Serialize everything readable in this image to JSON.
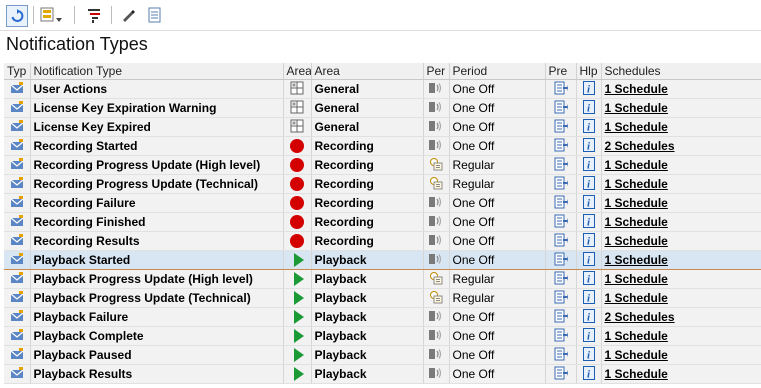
{
  "title": "Notification Types",
  "columns": {
    "typ": "Typ",
    "notification_type": "Notification Type",
    "area_icon": "Area",
    "area": "Area",
    "per": "Per",
    "period": "Period",
    "pre": "Pre",
    "hlp": "Hlp",
    "schedules": "Schedules"
  },
  "rows": [
    {
      "name": "User Actions",
      "area_icon": "table-icon",
      "area": "General",
      "per_icon": "once-icon",
      "period": "One Off",
      "schedules": "1 Schedule"
    },
    {
      "name": "License Key Expiration Warning",
      "area_icon": "table-icon",
      "area": "General",
      "per_icon": "once-icon",
      "period": "One Off",
      "schedules": "1 Schedule"
    },
    {
      "name": "License Key Expired",
      "area_icon": "table-icon",
      "area": "General",
      "per_icon": "once-icon",
      "period": "One Off",
      "schedules": "1 Schedule"
    },
    {
      "name": "Recording Started",
      "area_icon": "record-icon",
      "area": "Recording",
      "per_icon": "once-icon",
      "period": "One Off",
      "schedules": "2 Schedules"
    },
    {
      "name": "Recording Progress Update (High level)",
      "area_icon": "record-icon",
      "area": "Recording",
      "per_icon": "regular-icon",
      "period": "Regular",
      "schedules": "1 Schedule"
    },
    {
      "name": "Recording Progress Update (Technical)",
      "area_icon": "record-icon",
      "area": "Recording",
      "per_icon": "regular-icon",
      "period": "Regular",
      "schedules": "1 Schedule"
    },
    {
      "name": "Recording Failure",
      "area_icon": "record-icon",
      "area": "Recording",
      "per_icon": "once-icon",
      "period": "One Off",
      "schedules": "1 Schedule"
    },
    {
      "name": "Recording Finished",
      "area_icon": "record-icon",
      "area": "Recording",
      "per_icon": "once-icon",
      "period": "One Off",
      "schedules": "1 Schedule"
    },
    {
      "name": "Recording Results",
      "area_icon": "record-icon",
      "area": "Recording",
      "per_icon": "once-icon",
      "period": "One Off",
      "schedules": "1 Schedule"
    },
    {
      "name": "Playback Started",
      "area_icon": "play-icon",
      "area": "Playback",
      "per_icon": "once-icon",
      "period": "One Off",
      "schedules": "1 Schedule"
    },
    {
      "name": "Playback Progress Update (High level)",
      "area_icon": "play-icon",
      "area": "Playback",
      "per_icon": "regular-icon",
      "period": "Regular",
      "schedules": "1 Schedule"
    },
    {
      "name": "Playback Progress Update (Technical)",
      "area_icon": "play-icon",
      "area": "Playback",
      "per_icon": "regular-icon",
      "period": "Regular",
      "schedules": "1 Schedule"
    },
    {
      "name": "Playback Failure",
      "area_icon": "play-icon",
      "area": "Playback",
      "per_icon": "once-icon",
      "period": "One Off",
      "schedules": "2 Schedules"
    },
    {
      "name": "Playback Complete",
      "area_icon": "play-icon",
      "area": "Playback",
      "per_icon": "once-icon",
      "period": "One Off",
      "schedules": "1 Schedule"
    },
    {
      "name": "Playback Paused",
      "area_icon": "play-icon",
      "area": "Playback",
      "per_icon": "once-icon",
      "period": "One Off",
      "schedules": "1 Schedule"
    },
    {
      "name": "Playback Results",
      "area_icon": "play-icon",
      "area": "Playback",
      "per_icon": "once-icon",
      "period": "One Off",
      "schedules": "1 Schedule"
    }
  ],
  "selected_row": 9,
  "colors": {
    "record": "#d40000",
    "play": "#1b9a36",
    "selected_bg": "#d8e6f3",
    "selected_border": "#c98a4e",
    "info": "#1a5fb4"
  }
}
